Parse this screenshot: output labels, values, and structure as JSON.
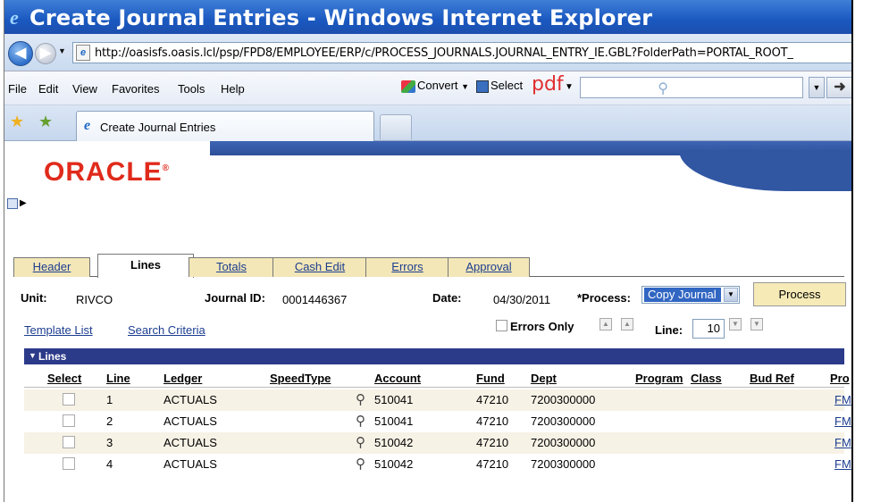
{
  "window": {
    "title": "Create Journal Entries - Windows Internet Explorer",
    "url": "http://oasisfs.oasis.lcl/psp/FPD8/EMPLOYEE/ERP/c/PROCESS_JOURNALS.JOURNAL_ENTRY_IE.GBL?FolderPath=PORTAL_ROOT_"
  },
  "menubar": {
    "items": [
      "File",
      "Edit",
      "View",
      "Favorites",
      "Tools",
      "Help"
    ],
    "convert": "Convert",
    "select": "Select",
    "pdf": "pdf"
  },
  "tabbar": {
    "tab_label": "Create Journal Entries"
  },
  "brand": {
    "logo": "ORACLE",
    "accent_red": "#e02a1b",
    "banner_blue": "#3157a3"
  },
  "page_tabs": [
    "Header",
    "Lines",
    "Totals",
    "Cash Edit",
    "Errors",
    "Approval"
  ],
  "form": {
    "unit_label": "Unit:",
    "unit_value": "RIVCO",
    "journal_label": "Journal ID:",
    "journal_value": "0001446367",
    "date_label": "Date:",
    "date_value": "04/30/2011",
    "process_label": "*Process:",
    "process_value": "Copy Journal",
    "process_button": "Process",
    "template_list": "Template List",
    "search_criteria": "Search Criteria",
    "errors_only": "Errors Only",
    "line_label": "Line:",
    "line_value": "10"
  },
  "grid": {
    "title": "Lines",
    "columns": [
      "Select",
      "Line",
      "Ledger",
      "SpeedType",
      "Account",
      "Fund",
      "Dept",
      "Program",
      "Class",
      "Bud Ref",
      "Pro"
    ],
    "rows": [
      {
        "line": "1",
        "ledger": "ACTUALS",
        "account": "510041",
        "fund": "47210",
        "dept": "7200300000",
        "pro": "FM"
      },
      {
        "line": "2",
        "ledger": "ACTUALS",
        "account": "510041",
        "fund": "47210",
        "dept": "7200300000",
        "pro": "FM"
      },
      {
        "line": "3",
        "ledger": "ACTUALS",
        "account": "510042",
        "fund": "47210",
        "dept": "7200300000",
        "pro": "FM"
      },
      {
        "line": "4",
        "ledger": "ACTUALS",
        "account": "510042",
        "fund": "47210",
        "dept": "7200300000",
        "pro": "FM"
      }
    ]
  }
}
